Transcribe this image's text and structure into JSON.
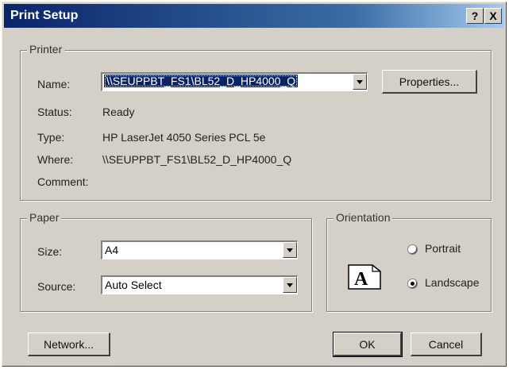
{
  "window": {
    "title": "Print Setup",
    "help_glyph": "?",
    "close_glyph": "X"
  },
  "printer": {
    "group_label": "Printer",
    "name_label": "Name:",
    "name_value": "\\\\SEUPPBT_FS1\\BL52_D_HP4000_Q",
    "properties_label": "Properties...",
    "status_label": "Status:",
    "status_value": "Ready",
    "type_label": "Type:",
    "type_value": "HP LaserJet 4050 Series PCL 5e",
    "where_label": "Where:",
    "where_value": "\\\\SEUPPBT_FS1\\BL52_D_HP4000_Q",
    "comment_label": "Comment:"
  },
  "paper": {
    "group_label": "Paper",
    "size_label": "Size:",
    "size_value": "A4",
    "source_label": "Source:",
    "source_value": "Auto Select"
  },
  "orientation": {
    "group_label": "Orientation",
    "icon_letter": "A",
    "portrait_label": "Portrait",
    "landscape_label": "Landscape",
    "selected": "Landscape"
  },
  "buttons": {
    "network_label": "Network...",
    "ok_label": "OK",
    "cancel_label": "Cancel"
  },
  "icons": {
    "help": "help-icon",
    "close": "close-icon",
    "dropdown": "chevron-down-icon",
    "orientation": "landscape-page-icon"
  },
  "colors": {
    "titlebar": "#0a246a",
    "dialog_face": "#d4d0c8",
    "selection": "#0a246a"
  }
}
